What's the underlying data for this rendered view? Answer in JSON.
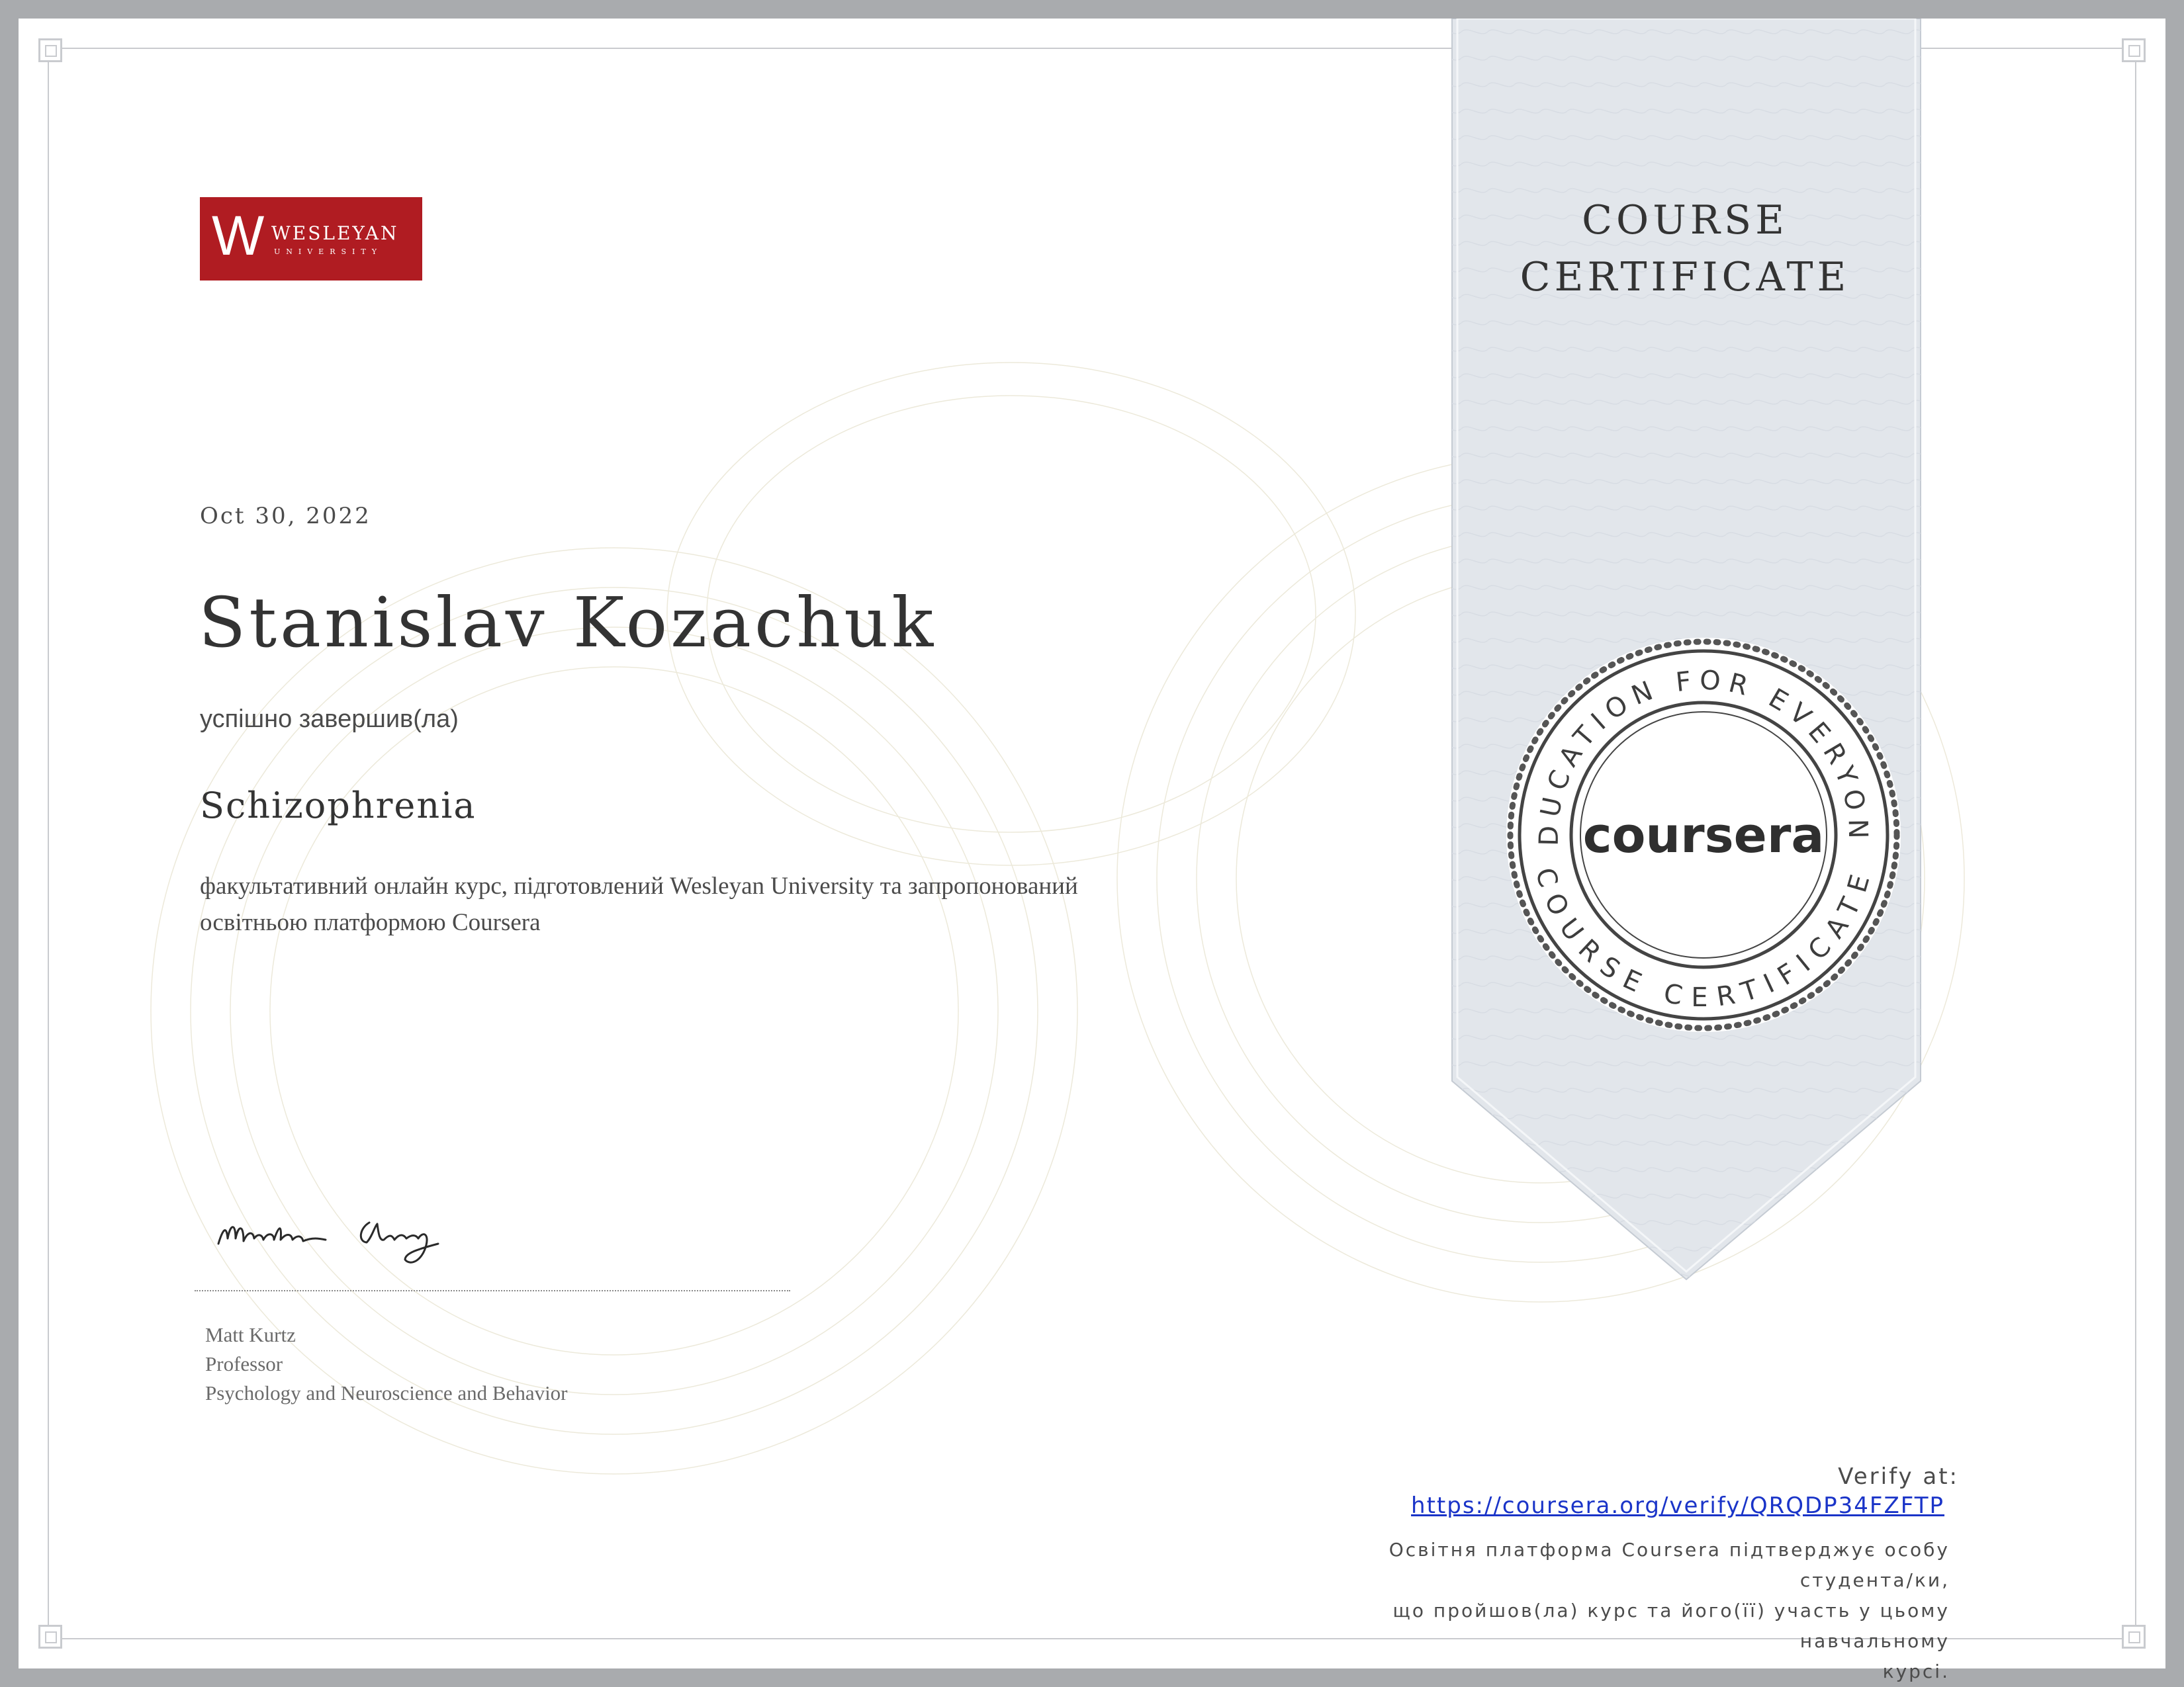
{
  "institution": {
    "logo_letter": "W",
    "logo_name": "WESLEYAN",
    "logo_subtitle": "UNIVERSITY",
    "logo_color": "#b01c22"
  },
  "certificate": {
    "date": "Oct 30, 2022",
    "recipient_name": "Stanislav Kozachuk",
    "completed_label": "успішно завершив(ла)",
    "course_name": "Schizophrenia",
    "description_line1": "факультативний онлайн курс, підготовлений Wesleyan University та запропонований",
    "description_line2": "освітньою платформою Coursera"
  },
  "signer": {
    "name": "Matt Kurtz",
    "title": "Professor",
    "department": "Psychology and Neuroscience and Behavior"
  },
  "ribbon": {
    "title_line1": "COURSE",
    "title_line2": "CERTIFICATE",
    "color": "#e2e6eb"
  },
  "seal": {
    "top_text": "EDUCATION FOR EVERYONE",
    "bottom_text": "COURSE CERTIFICATE",
    "brand": "coursera"
  },
  "verification": {
    "label": "Verify at:",
    "url": "https://coursera.org/verify/QRQDP34FZFTP",
    "note_line1": "Освітня платформа Coursera підтверджує особу студента/ки,",
    "note_line2": "що пройшов(ла) курс та його(її) участь у цьому навчальному",
    "note_line3": "курсі."
  }
}
